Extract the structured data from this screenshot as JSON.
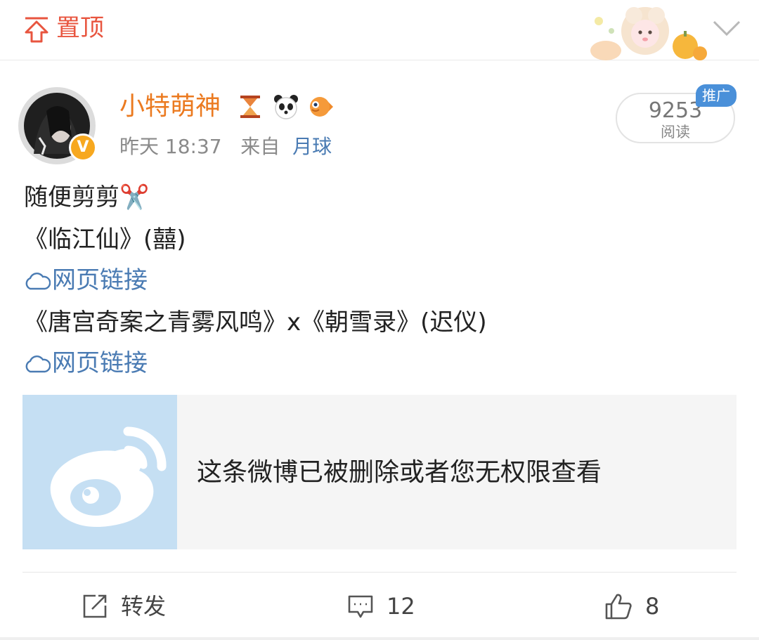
{
  "pinned": {
    "label": "置顶"
  },
  "post": {
    "author": "小特萌神",
    "time": "昨天 18:37",
    "source_prefix": "来自",
    "source": "月球",
    "verified_mark": "V",
    "read_count": "9253",
    "read_label": "阅读",
    "promo_tag": "推广",
    "lines": [
      "随便剪剪✂️",
      "《临江仙》(囍)",
      "网页链接",
      "《唐宫奇案之青雾风鸣》x《朝雪录》(迟仪)",
      "网页链接"
    ],
    "repost_notice": "这条微博已被删除或者您无权限查看"
  },
  "actions": {
    "repost": "转发",
    "comments": "12",
    "likes": "8"
  },
  "icons": {
    "pin": "pin-top-icon",
    "dropdown": "chevron-down-icon",
    "link": "cloud-link-icon",
    "repost": "share-icon",
    "comment": "comment-icon",
    "like": "thumbs-up-icon"
  },
  "colors": {
    "accent_red": "#e8553f",
    "author_orange": "#eb7a20",
    "link_blue": "#4a7bb3",
    "promo_blue": "#4a90d9",
    "card_bg": "#f5f5f5",
    "thumb_bg": "#c5dff3"
  }
}
